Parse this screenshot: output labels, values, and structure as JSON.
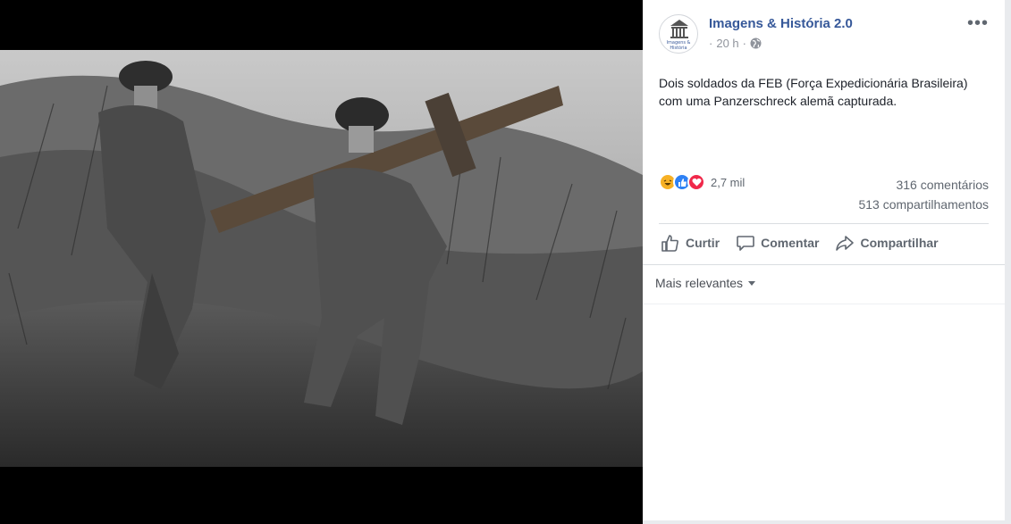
{
  "post": {
    "page_name": "Imagens & História 2.0",
    "avatar_caption": "Imagens & História",
    "time": "20 h",
    "separator": "·",
    "text": "Dois soldados da FEB (Força Expedicionária Brasileira) com uma Panzerschreck alemã capturada.",
    "more_label": "•••"
  },
  "reactions": {
    "types": [
      "haha",
      "like",
      "love"
    ],
    "count": "2,7 mil"
  },
  "stats": {
    "comments": "316 comentários",
    "shares": "513 compartilhamentos"
  },
  "actions": {
    "like": "Curtir",
    "comment": "Comentar",
    "share": "Compartilhar"
  },
  "comments": {
    "sort_label": "Mais relevantes"
  },
  "photo": {
    "description_icon": "photo-image"
  },
  "colors": {
    "link_blue": "#365899",
    "meta_grey": "#90949c",
    "text": "#1d2129"
  }
}
